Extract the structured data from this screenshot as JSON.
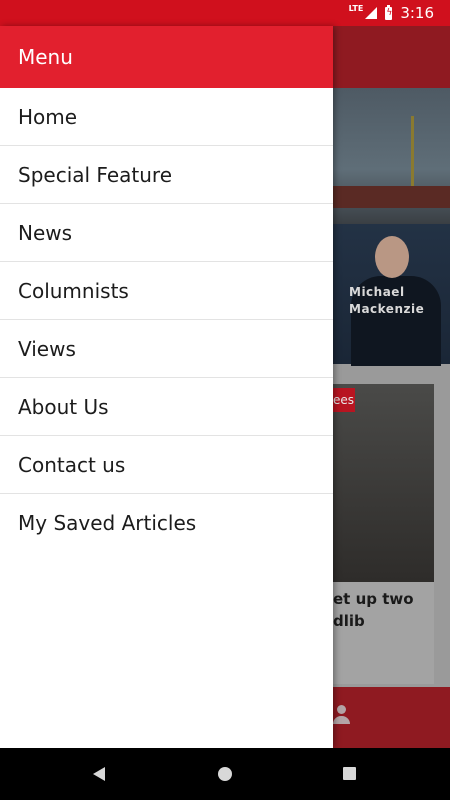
{
  "status_bar": {
    "network": "LTE",
    "time": "3:16",
    "colors": {
      "background": "#d0101d"
    }
  },
  "drawer": {
    "title": "Menu",
    "items": [
      {
        "label": "Home"
      },
      {
        "label": "Special Feature"
      },
      {
        "label": "News"
      },
      {
        "label": "Columnists"
      },
      {
        "label": "Views"
      },
      {
        "label": "About Us"
      },
      {
        "label": "Contact us"
      },
      {
        "label": "My Saved Articles"
      }
    ],
    "colors": {
      "header": "#e2202e"
    }
  },
  "background": {
    "author_line1": "Michael",
    "author_line2": "Mackenzie",
    "tag": "ees",
    "card_title_line1": "et up two",
    "card_title_line2": "dlib"
  },
  "icons": {
    "nav_back": "triangle-back-icon",
    "nav_home": "circle-home-icon",
    "nav_recent": "square-recent-icon",
    "profile": "person-icon"
  }
}
